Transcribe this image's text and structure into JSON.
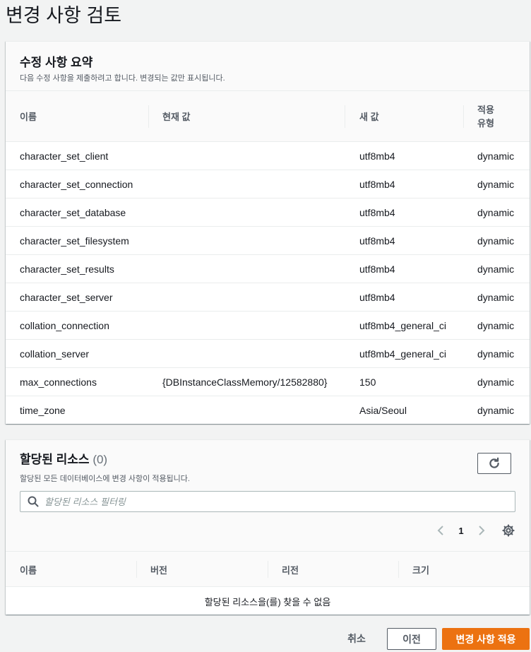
{
  "page": {
    "title": "변경 사항 검토"
  },
  "summary": {
    "title": "수정 사항 요약",
    "description": "다음 수정 사항을 제출하려고 합니다. 변경되는 값만 표시됩니다.",
    "columns": {
      "name": "이름",
      "current": "현재 값",
      "new": "새 값",
      "apply_type": "적용\n유형"
    },
    "rows": [
      {
        "name": "character_set_client",
        "current": "",
        "new": "utf8mb4",
        "apply_type": "dynamic"
      },
      {
        "name": "character_set_connection",
        "current": "",
        "new": "utf8mb4",
        "apply_type": "dynamic"
      },
      {
        "name": "character_set_database",
        "current": "",
        "new": "utf8mb4",
        "apply_type": "dynamic"
      },
      {
        "name": "character_set_filesystem",
        "current": "",
        "new": "utf8mb4",
        "apply_type": "dynamic"
      },
      {
        "name": "character_set_results",
        "current": "",
        "new": "utf8mb4",
        "apply_type": "dynamic"
      },
      {
        "name": "character_set_server",
        "current": "",
        "new": "utf8mb4",
        "apply_type": "dynamic"
      },
      {
        "name": "collation_connection",
        "current": "",
        "new": "utf8mb4_general_ci",
        "apply_type": "dynamic"
      },
      {
        "name": "collation_server",
        "current": "",
        "new": "utf8mb4_general_ci",
        "apply_type": "dynamic"
      },
      {
        "name": "max_connections",
        "current": "{DBInstanceClassMemory/12582880}",
        "new": "150",
        "apply_type": "dynamic"
      },
      {
        "name": "time_zone",
        "current": "",
        "new": "Asia/Seoul",
        "apply_type": "dynamic"
      }
    ]
  },
  "resources": {
    "title": "할당된 리소스",
    "count": "(0)",
    "description": "할당된 모든 데이터베이스에 변경 사항이 적용됩니다.",
    "search_placeholder": "할당된 리소스 필터링",
    "page_number": "1",
    "columns": {
      "name": "이름",
      "version": "버전",
      "region": "리전",
      "size": "크기"
    },
    "empty_text": "할당된 리소스을(를) 찾을 수 없음",
    "icons": {
      "refresh": "refresh-icon",
      "search": "search-icon",
      "prev": "chevron-left-icon",
      "next": "chevron-right-icon",
      "settings": "gear-icon"
    }
  },
  "footer": {
    "cancel_label": "취소",
    "previous_label": "이전",
    "apply_label": "변경 사항 적용"
  },
  "colors": {
    "primary": "#ec7211",
    "text": "#16191f",
    "muted": "#545b64",
    "background": "#f2f3f3"
  }
}
